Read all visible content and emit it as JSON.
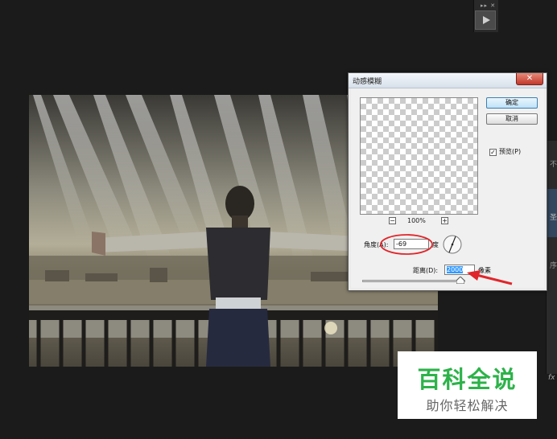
{
  "dialog": {
    "title": "动感模糊",
    "close_glyph": "✕",
    "ok_label": "确定",
    "cancel_label": "取消",
    "preview_label": "预览(P)",
    "preview_checked": true,
    "zoom_out_glyph": "−",
    "zoom_in_glyph": "+",
    "zoom_level": "100%",
    "angle_label": "角度(A):",
    "angle_value": "-69",
    "angle_unit": "度",
    "distance_label": "距离(D):",
    "distance_value": "2000",
    "distance_unit": "像素"
  },
  "panels": {
    "grip": "▸▸ ✕",
    "tab_letters": [
      "不",
      "圣",
      "序"
    ],
    "fx_label": "fx"
  },
  "watermark": {
    "title": "百科全说",
    "subtitle": "助你轻松解决"
  },
  "colors": {
    "annotation_red": "#e0262b",
    "watermark_green": "#2db24a",
    "default_button_blue": "#3c7fb1",
    "selection_blue": "#3399ff"
  },
  "icons": {
    "play": "play-icon",
    "close": "close-icon",
    "angle_dial": "angle-dial-icon",
    "slider_thumb": "slider-thumb-icon",
    "arrow": "red-arrow-annotation"
  }
}
